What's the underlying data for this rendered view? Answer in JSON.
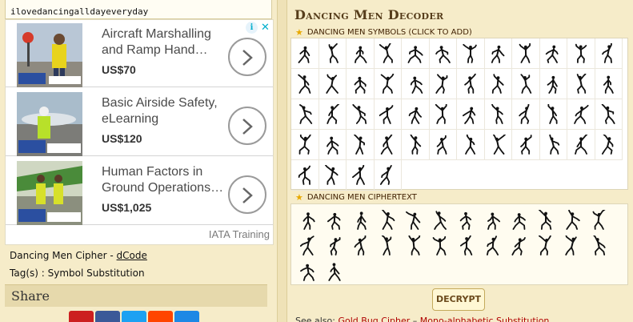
{
  "input_text": "ilovedancingalldayeveryday",
  "ad": {
    "items": [
      {
        "title": "Aircraft Marshalling and Ramp Hand…",
        "price": "US$70"
      },
      {
        "title": "Basic Airside Safety, eLearning",
        "price": "US$120"
      },
      {
        "title": "Human Factors in Ground Operations…",
        "price": "US$1,025"
      }
    ],
    "brand": "IATA Training"
  },
  "info": {
    "cipher_label": "Dancing Men Cipher - ",
    "cipher_link": "dCode",
    "tags_label": "Tag(s) : Symbol Substitution"
  },
  "share": {
    "title": "Share",
    "buttons": [
      "youtube",
      "facebook",
      "twitter",
      "reddit",
      "email"
    ]
  },
  "decoder": {
    "title": "Dancing Men Decoder",
    "symbols_label": "DANCING MEN SYMBOLS (CLICK TO ADD)",
    "symbol_count": 52,
    "ciphertext_label": "DANCING MEN CIPHERTEXT",
    "ciphertext_count": 26,
    "decrypt_label": "DECRYPT",
    "see_also_prefix": "See also:",
    "see_also_links": [
      "Gold Bug Cipher",
      "Mono-alphabetic Substitution"
    ]
  },
  "colors": {
    "bg": "#f6ecc9",
    "accent": "#563d1b",
    "link": "#b00000",
    "star": "#e8a900"
  }
}
